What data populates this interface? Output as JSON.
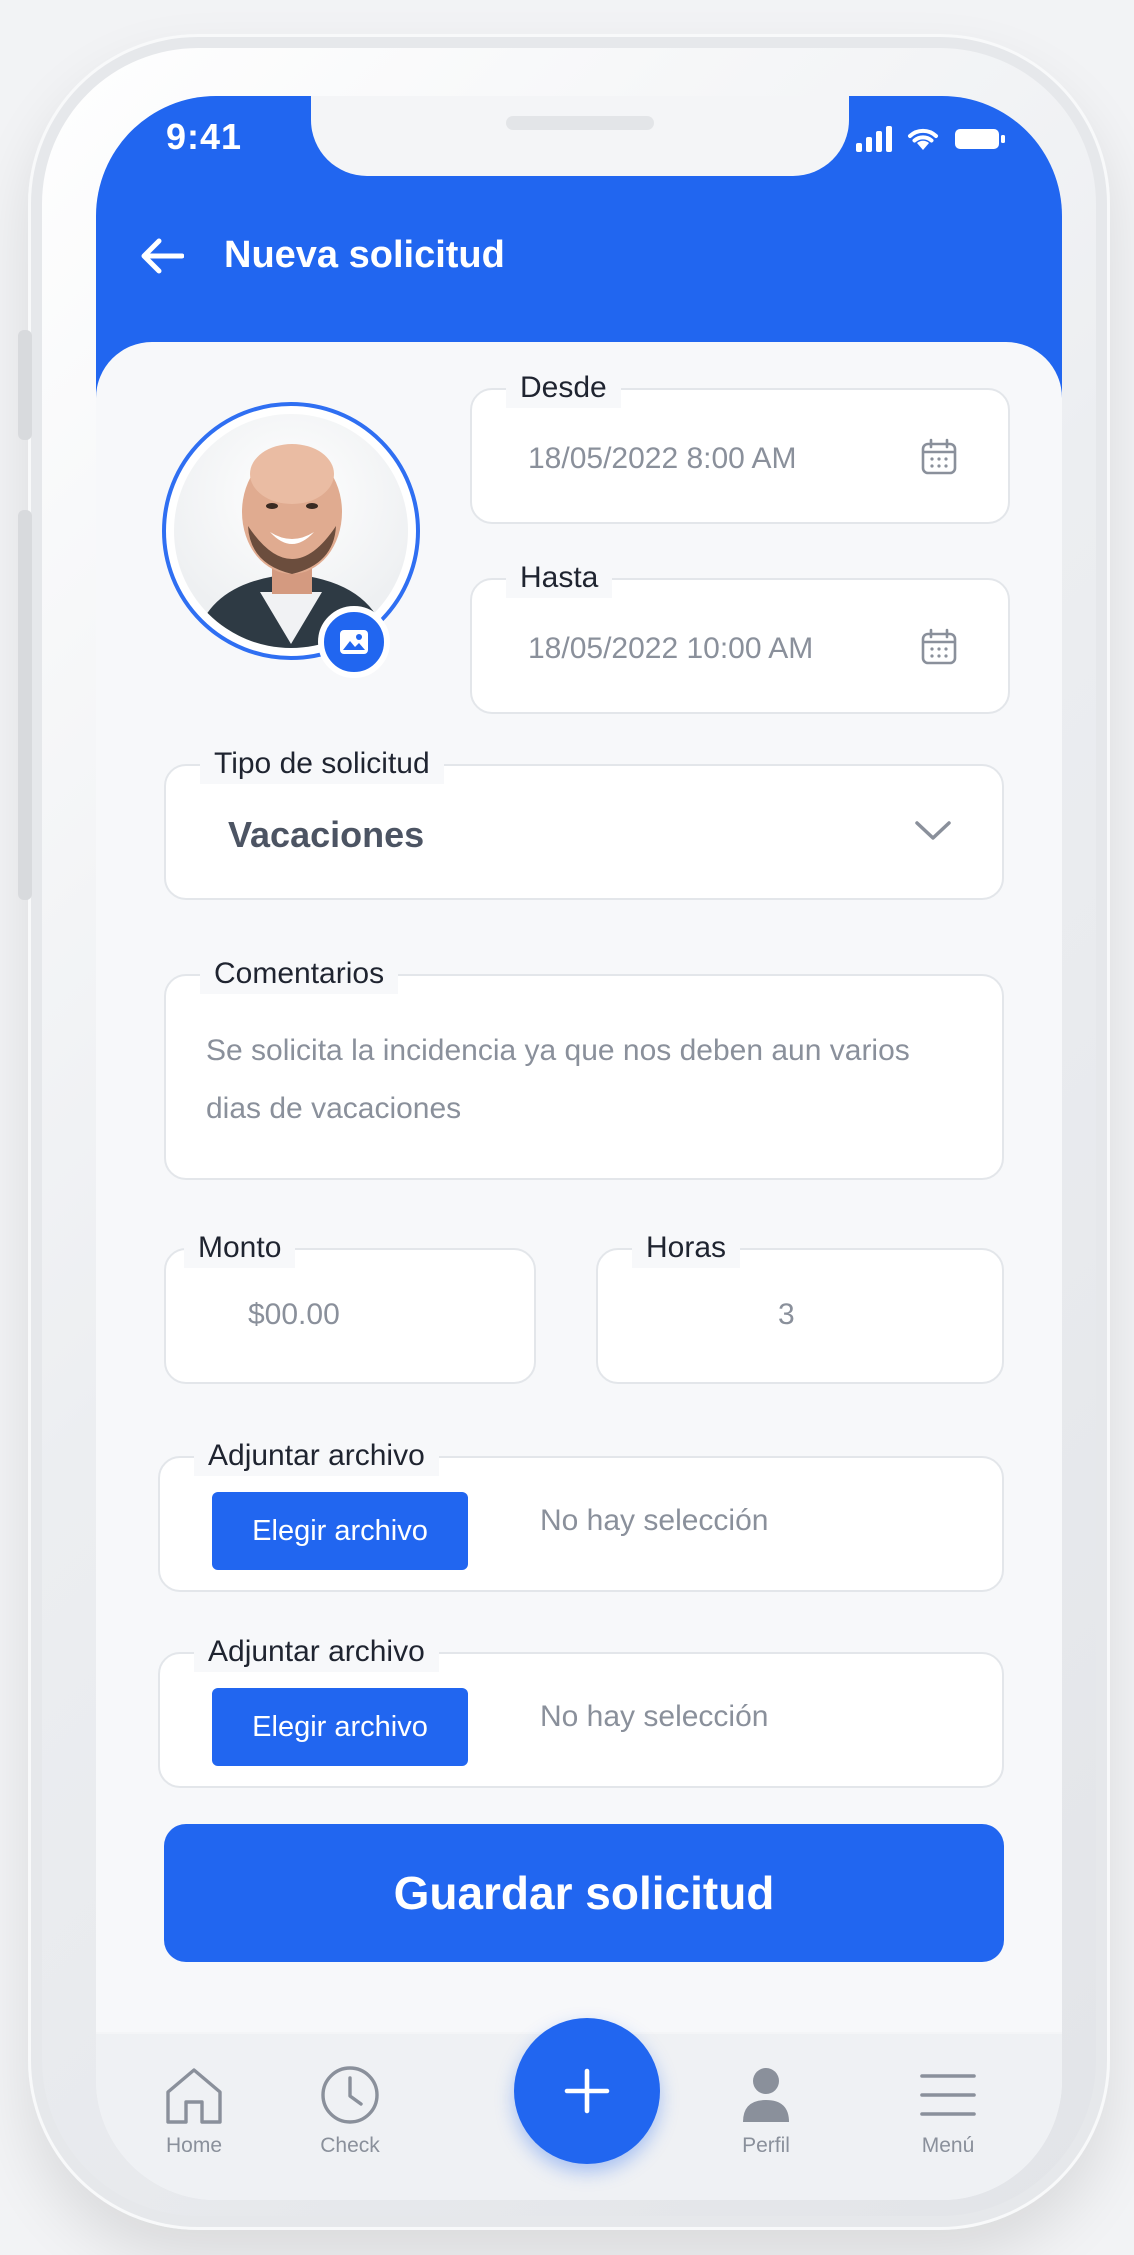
{
  "status_bar": {
    "time": "9:41"
  },
  "header": {
    "title": "Nueva solicitud"
  },
  "form": {
    "desde": {
      "label": "Desde",
      "value": "18/05/2022 8:00 AM"
    },
    "hasta": {
      "label": "Hasta",
      "value": "18/05/2022 10:00 AM"
    },
    "tipo": {
      "label": "Tipo de solicitud",
      "value": "Vacaciones"
    },
    "comentarios": {
      "label": "Comentarios",
      "value": "Se solicita la incidencia ya que nos deben aun varios dias de vacaciones"
    },
    "monto": {
      "label": "Monto",
      "value": "$00.00"
    },
    "horas": {
      "label": "Horas",
      "value": "3"
    },
    "adjunto1": {
      "label": "Adjuntar archivo",
      "button": "Elegir archivo",
      "status": "No hay selección"
    },
    "adjunto2": {
      "label": "Adjuntar archivo",
      "button": "Elegir archivo",
      "status": "No hay selección"
    },
    "submit_label": "Guardar solicitud"
  },
  "bottom_nav": {
    "items": [
      {
        "label": "Home",
        "icon": "home-icon"
      },
      {
        "label": "Check",
        "icon": "clock-icon"
      },
      {
        "label": "",
        "icon": "plus-icon"
      },
      {
        "label": "Perfil",
        "icon": "user-icon"
      },
      {
        "label": "Menú",
        "icon": "menu-icon"
      }
    ]
  },
  "colors": {
    "primary": "#2166f0",
    "background": "#f4f5f7",
    "text_muted": "#8a909b"
  }
}
